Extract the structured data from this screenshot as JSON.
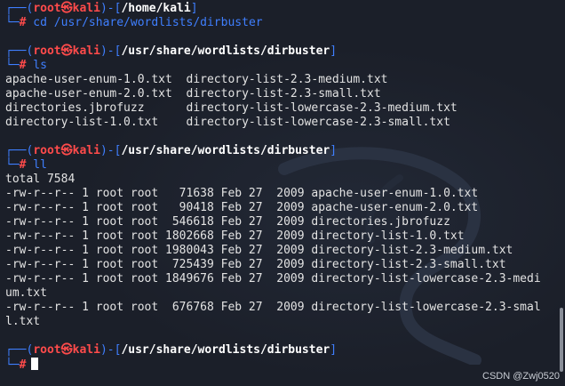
{
  "prompt_user": "root",
  "prompt_skull": "㉿",
  "prompt_host": "kali",
  "hash": "#",
  "blocks": [
    {
      "path": "/home/kali",
      "command": "cd /usr/share/wordlists/dirbuster",
      "output": []
    },
    {
      "path": "/usr/share/wordlists/dirbuster",
      "command": "ls",
      "output": [
        "apache-user-enum-1.0.txt  directory-list-2.3-medium.txt",
        "apache-user-enum-2.0.txt  directory-list-2.3-small.txt",
        "directories.jbrofuzz      directory-list-lowercase-2.3-medium.txt",
        "directory-list-1.0.txt    directory-list-lowercase-2.3-small.txt"
      ]
    },
    {
      "path": "/usr/share/wordlists/dirbuster",
      "command": "ll",
      "output": [
        "total 7584",
        "-rw-r--r-- 1 root root   71638 Feb 27  2009 apache-user-enum-1.0.txt",
        "-rw-r--r-- 1 root root   90418 Feb 27  2009 apache-user-enum-2.0.txt",
        "-rw-r--r-- 1 root root  546618 Feb 27  2009 directories.jbrofuzz",
        "-rw-r--r-- 1 root root 1802668 Feb 27  2009 directory-list-1.0.txt",
        "-rw-r--r-- 1 root root 1980043 Feb 27  2009 directory-list-2.3-medium.txt",
        "-rw-r--r-- 1 root root  725439 Feb 27  2009 directory-list-2.3-small.txt",
        "-rw-r--r-- 1 root root 1849676 Feb 27  2009 directory-list-lowercase-2.3-medi",
        "um.txt",
        "-rw-r--r-- 1 root root  676768 Feb 27  2009 directory-list-lowercase-2.3-smal",
        "l.txt"
      ]
    },
    {
      "path": "/usr/share/wordlists/dirbuster",
      "command": "",
      "output": []
    }
  ],
  "watermark": "CSDN @Zwj0520",
  "colors": {
    "background": "#1b1f29",
    "prompt_blue": "#3f7fff",
    "user_red": "#ff4b4b",
    "text": "#e3e3e3"
  }
}
